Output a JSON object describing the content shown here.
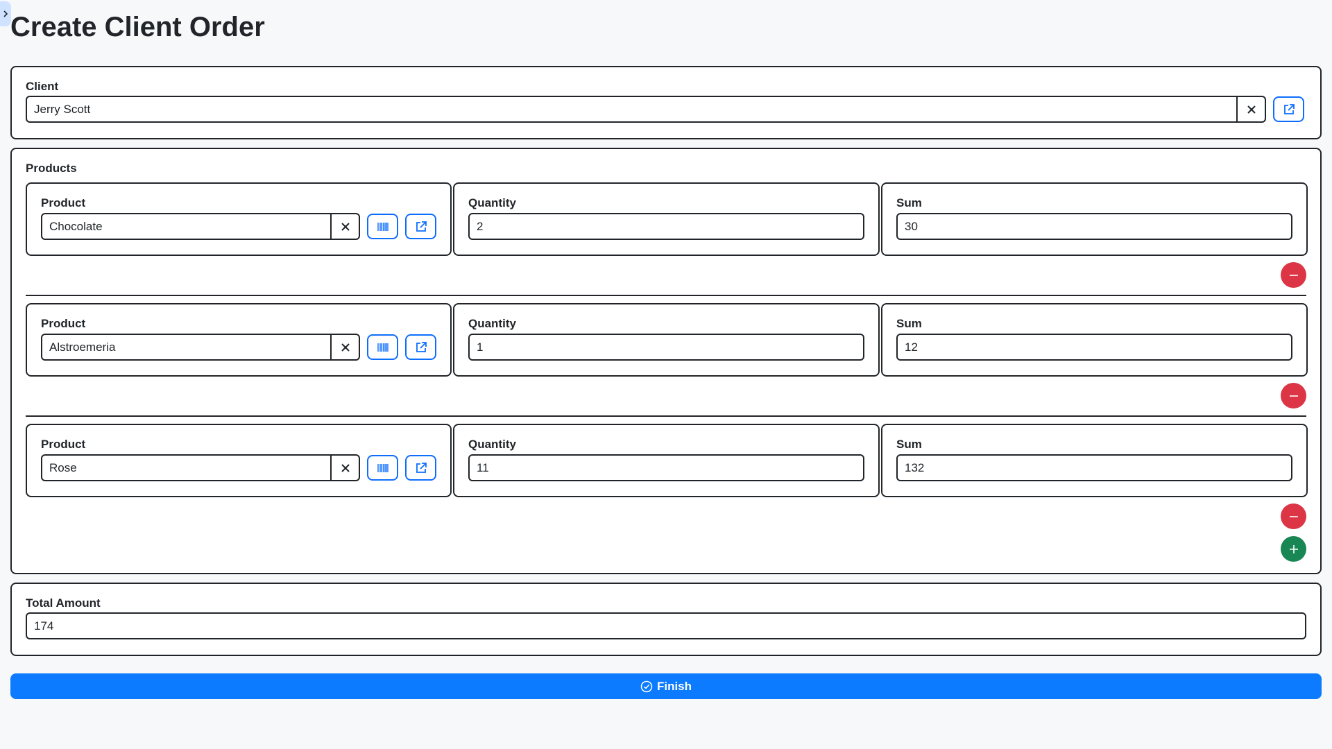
{
  "page": {
    "title": "Create Client Order"
  },
  "client": {
    "label": "Client",
    "value": "Jerry Scott"
  },
  "products": {
    "label": "Products",
    "product_label": "Product",
    "quantity_label": "Quantity",
    "sum_label": "Sum",
    "items": [
      {
        "product": "Chocolate",
        "quantity": "2",
        "sum": "30"
      },
      {
        "product": "Alstroemeria",
        "quantity": "1",
        "sum": "12"
      },
      {
        "product": "Rose",
        "quantity": "11",
        "sum": "132"
      }
    ]
  },
  "total": {
    "label": "Total Amount",
    "value": "174"
  },
  "finish": {
    "label": "Finish"
  },
  "colors": {
    "primary": "#0d7bff",
    "danger": "#dc3545",
    "success": "#198754"
  }
}
